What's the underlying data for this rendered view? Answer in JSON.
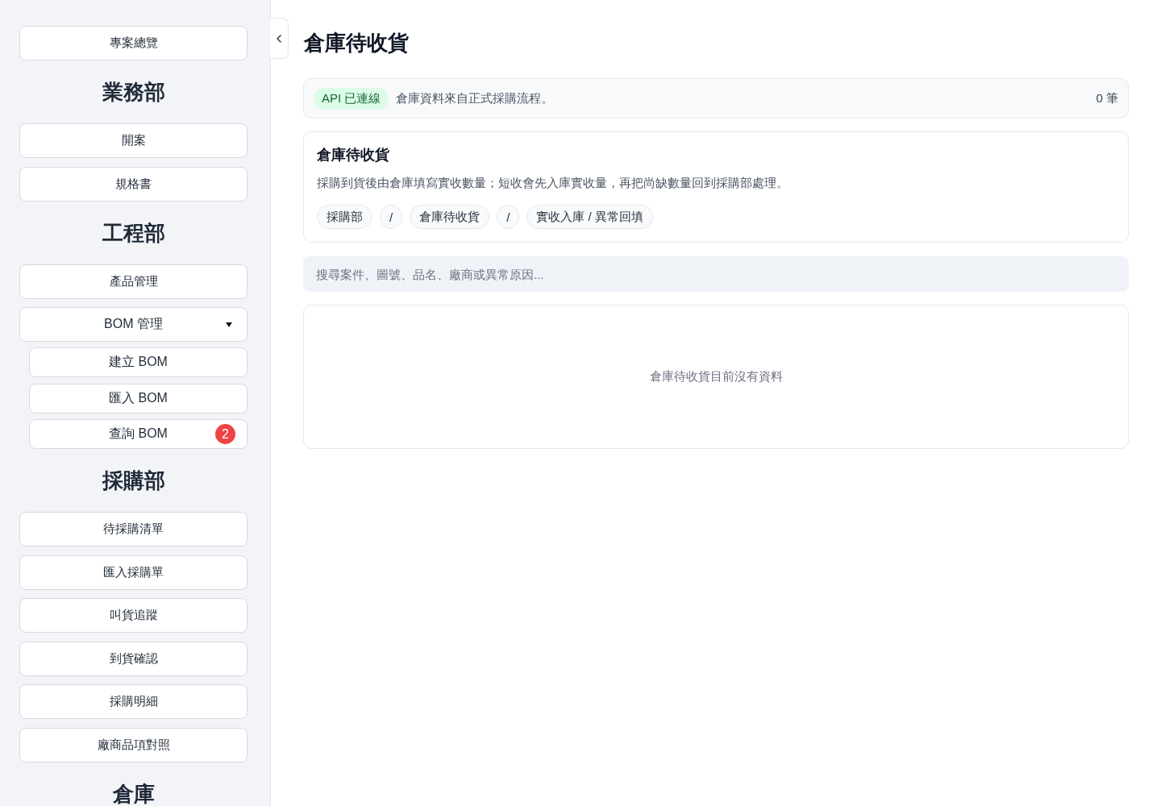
{
  "sidebar": {
    "entries": [
      {
        "kind": "link",
        "label": "專案總覽"
      },
      {
        "kind": "heading",
        "label": "業務部"
      },
      {
        "kind": "link",
        "label": "開案"
      },
      {
        "kind": "link",
        "label": "規格書"
      },
      {
        "kind": "heading",
        "label": "工程部"
      },
      {
        "kind": "link",
        "label": "產品管理"
      },
      {
        "kind": "group",
        "label": "BOM 管理",
        "expanded": true,
        "children": [
          {
            "label": "建立 BOM"
          },
          {
            "label": "匯入 BOM"
          },
          {
            "label": "查詢 BOM",
            "badge": "2"
          }
        ]
      },
      {
        "kind": "heading",
        "label": "採購部"
      },
      {
        "kind": "link",
        "label": "待採購清單"
      },
      {
        "kind": "link",
        "label": "匯入採購單"
      },
      {
        "kind": "link",
        "label": "叫貨追蹤"
      },
      {
        "kind": "link",
        "label": "到貨確認"
      },
      {
        "kind": "link",
        "label": "採購明細"
      },
      {
        "kind": "link",
        "label": "廠商品項對照"
      },
      {
        "kind": "heading",
        "label": "倉庫"
      }
    ]
  },
  "page": {
    "title": "倉庫待收貨"
  },
  "status_bar": {
    "badge": "API 已連線",
    "message": "倉庫資料來自正式採購流程。",
    "count": "0 筆"
  },
  "info_card": {
    "title": "倉庫待收貨",
    "description": "採購到貨後由倉庫填寫實收數量；短收會先入庫實收量，再把尚缺數量回到採購部處理。",
    "breadcrumb": [
      "採購部",
      "/",
      "倉庫待收貨",
      "/",
      "實收入庫 / 異常回填"
    ]
  },
  "search": {
    "placeholder": "搜尋案件、圖號、品名、廠商或異常原因..."
  },
  "results": {
    "empty_message": "倉庫待收貨目前沒有資料"
  }
}
